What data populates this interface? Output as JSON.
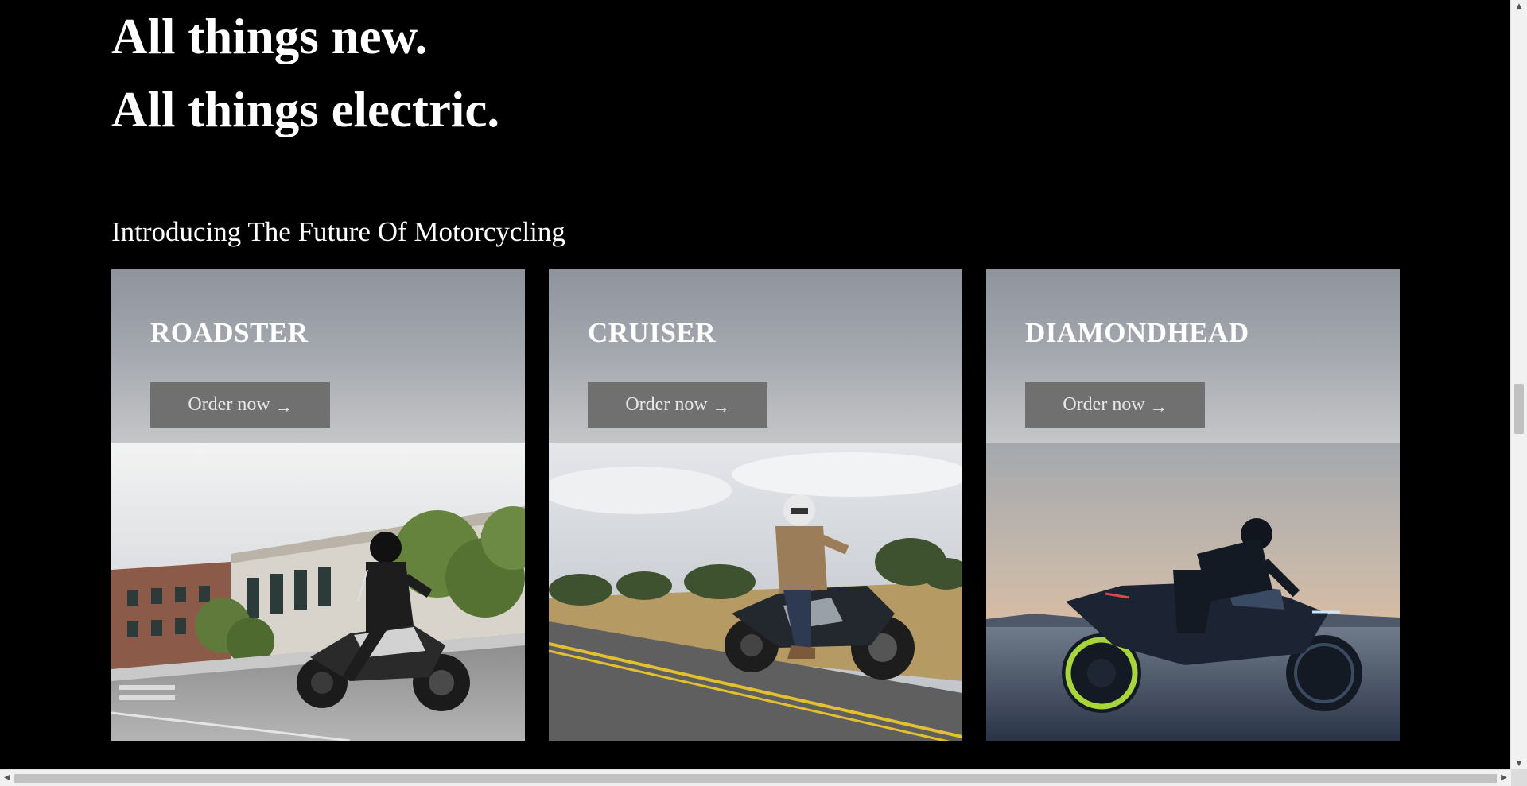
{
  "hero": {
    "line1": "All things new.",
    "line2": "All things electric."
  },
  "section": {
    "subtitle": "Introducing The Future Of Motorcycling"
  },
  "cards": [
    {
      "title": "ROADSTER",
      "button_label": "Order now",
      "button_icon": "arrow-right-icon",
      "image": "rider-on-roadster-motorcycle-city-street"
    },
    {
      "title": "CRUISER",
      "button_label": "Order now",
      "button_icon": "arrow-right-icon",
      "image": "rider-on-cruiser-motorcycle-country-road"
    },
    {
      "title": "DIAMONDHEAD",
      "button_label": "Order now",
      "button_icon": "arrow-right-icon",
      "image": "rider-on-diamondhead-motorcycle-dusk-salt-flat"
    }
  ],
  "colors": {
    "background": "#000000",
    "card_header_top": "#8f939c",
    "card_header_bottom": "#c5c6c8",
    "button_bg": "#707070",
    "text": "#ffffff"
  }
}
